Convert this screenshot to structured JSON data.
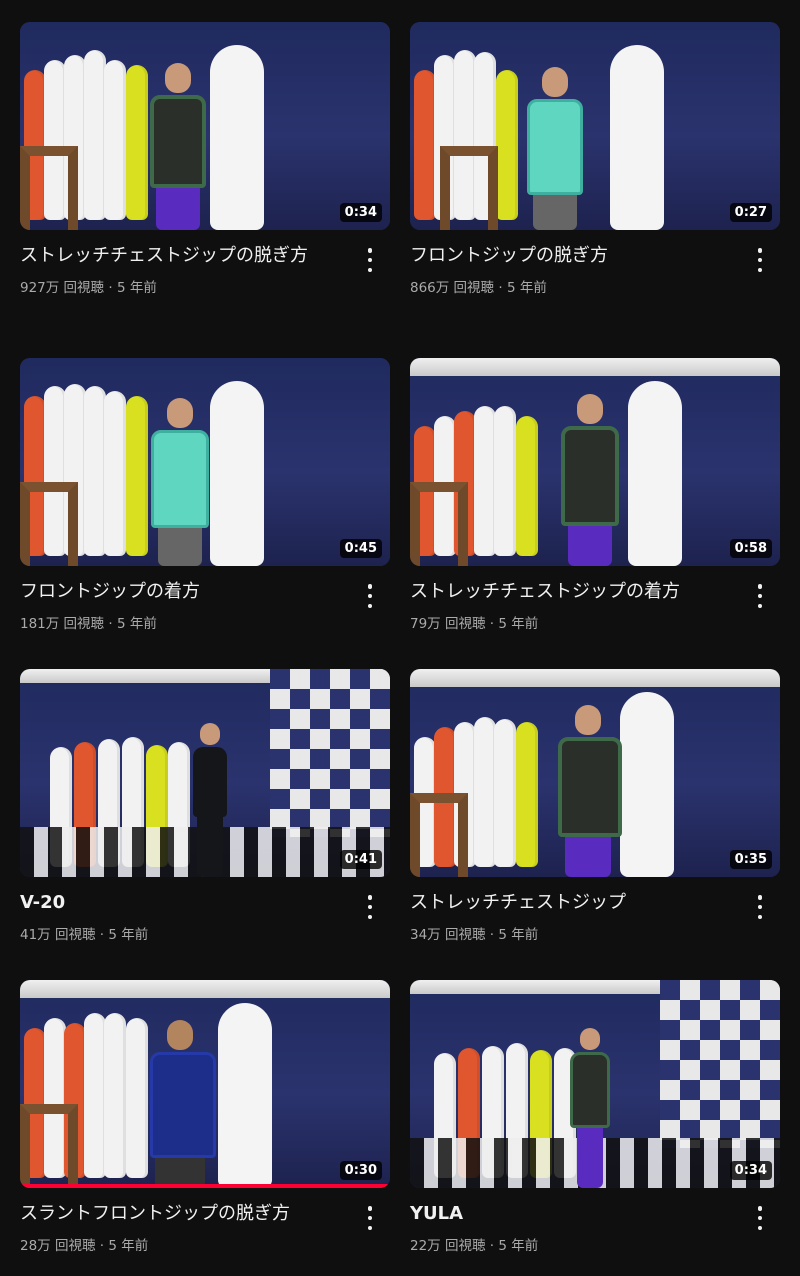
{
  "videos": [
    {
      "title": "ストレッチチェストジップの脱ぎ方",
      "views": "927万 回視聴",
      "age": "5 年前",
      "duration": "0:34",
      "sep": " · "
    },
    {
      "title": "フロントジップの脱ぎ方",
      "views": "866万 回視聴",
      "age": "5 年前",
      "duration": "0:27",
      "sep": " · "
    },
    {
      "title": "フロントジップの着方",
      "views": "181万 回視聴",
      "age": "5 年前",
      "duration": "0:45",
      "sep": " · "
    },
    {
      "title": "ストレッチチェストジップの着方",
      "views": "79万 回視聴",
      "age": "5 年前",
      "duration": "0:58",
      "sep": " · "
    },
    {
      "title": "V-20",
      "views": "41万 回視聴",
      "age": "5 年前",
      "duration": "0:41",
      "sep": " · "
    },
    {
      "title": "ストレッチチェストジップ",
      "views": "34万 回視聴",
      "age": "5 年前",
      "duration": "0:35",
      "sep": " · "
    },
    {
      "title": "スラントフロントジップの脱ぎ方",
      "views": "28万 回視聴",
      "age": "5 年前",
      "duration": "0:30",
      "sep": " · ",
      "watched_fraction": 1.0
    },
    {
      "title": "YULA",
      "views": "22万 回視聴",
      "age": "5 年前",
      "duration": "0:34",
      "sep": " · "
    }
  ],
  "icons": {
    "more": "more-vert-icon"
  },
  "colors": {
    "background": "#0f0f0f",
    "progress": "#ff0033",
    "meta": "#aaaaaa"
  }
}
